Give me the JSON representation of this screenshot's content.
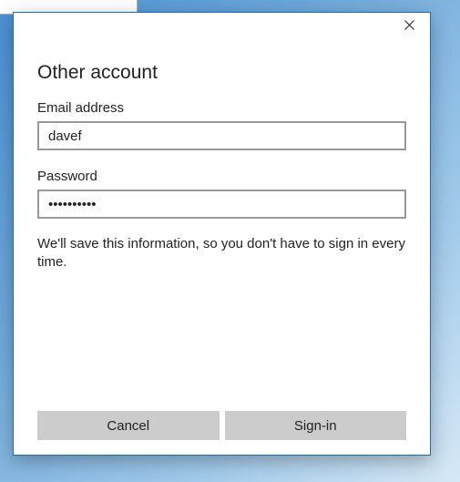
{
  "dialog": {
    "title": "Other account",
    "email_label": "Email address",
    "email_value": "davef",
    "password_label": "Password",
    "password_value": "••••••••••",
    "info_text": "We'll save this information, so you don't have to sign in every time.",
    "cancel_label": "Cancel",
    "signin_label": "Sign-in"
  }
}
